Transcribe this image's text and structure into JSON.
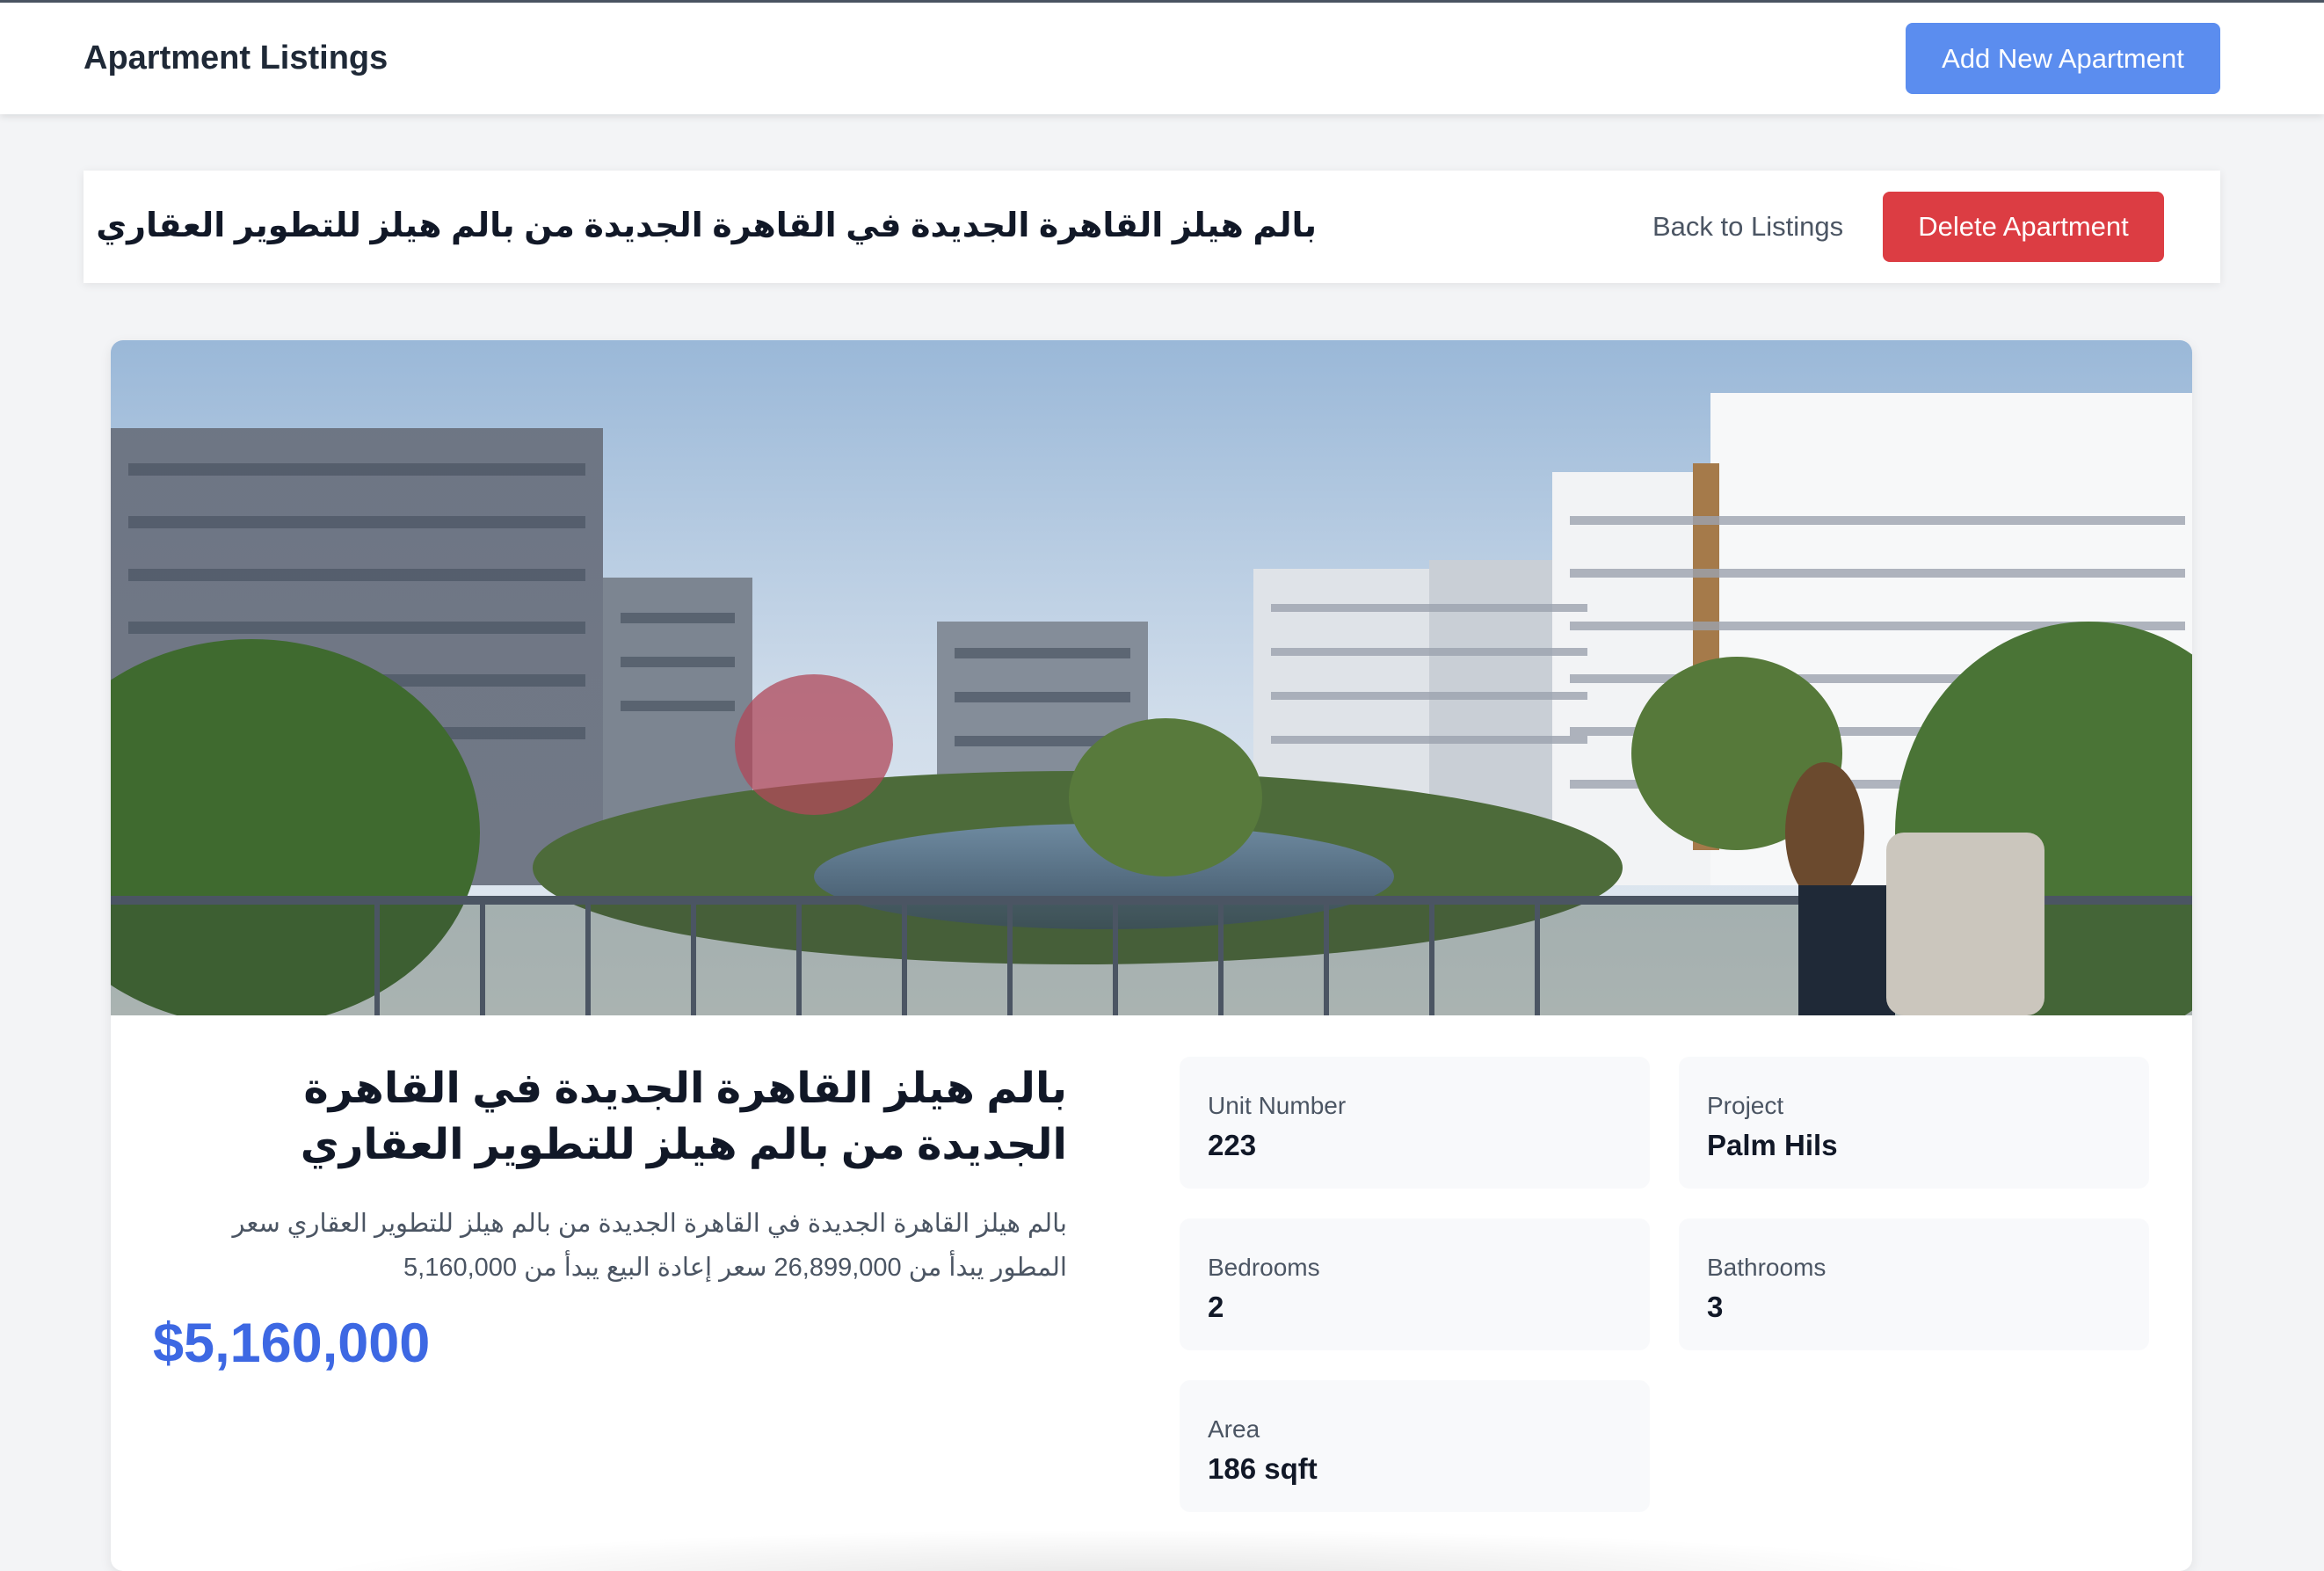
{
  "navbar": {
    "title": "Apartment Listings",
    "add_button_label": "Add New Apartment"
  },
  "header": {
    "title": "بالم هيلز القاهرة الجديدة في القاهرة الجديدة من بالم هيلز للتطوير العقاري",
    "back_link_label": "Back to Listings",
    "delete_button_label": "Delete Apartment"
  },
  "listing": {
    "title": "بالم هيلز القاهرة الجديدة في القاهرة الجديدة من بالم هيلز للتطوير العقاري",
    "description": "بالم هيلز القاهرة الجديدة في القاهرة الجديدة من بالم هيلز للتطوير العقاري سعر المطور يبدأ من 26,899,000 سعر إعادة البيع يبدأ من 5,160,000",
    "price": "$5,160,000",
    "image_alt": "Residential compound balcony view"
  },
  "stats": {
    "unit_number": {
      "label": "Unit Number",
      "value": "223"
    },
    "project": {
      "label": "Project",
      "value": "Palm Hils"
    },
    "bedrooms": {
      "label": "Bedrooms",
      "value": "2"
    },
    "bathrooms": {
      "label": "Bathrooms",
      "value": "3"
    },
    "area": {
      "label": "Area",
      "value": "186 sqft"
    }
  },
  "colors": {
    "add_button": "#5b8def",
    "delete_button": "#dc3d43",
    "price": "#3d68e3"
  }
}
